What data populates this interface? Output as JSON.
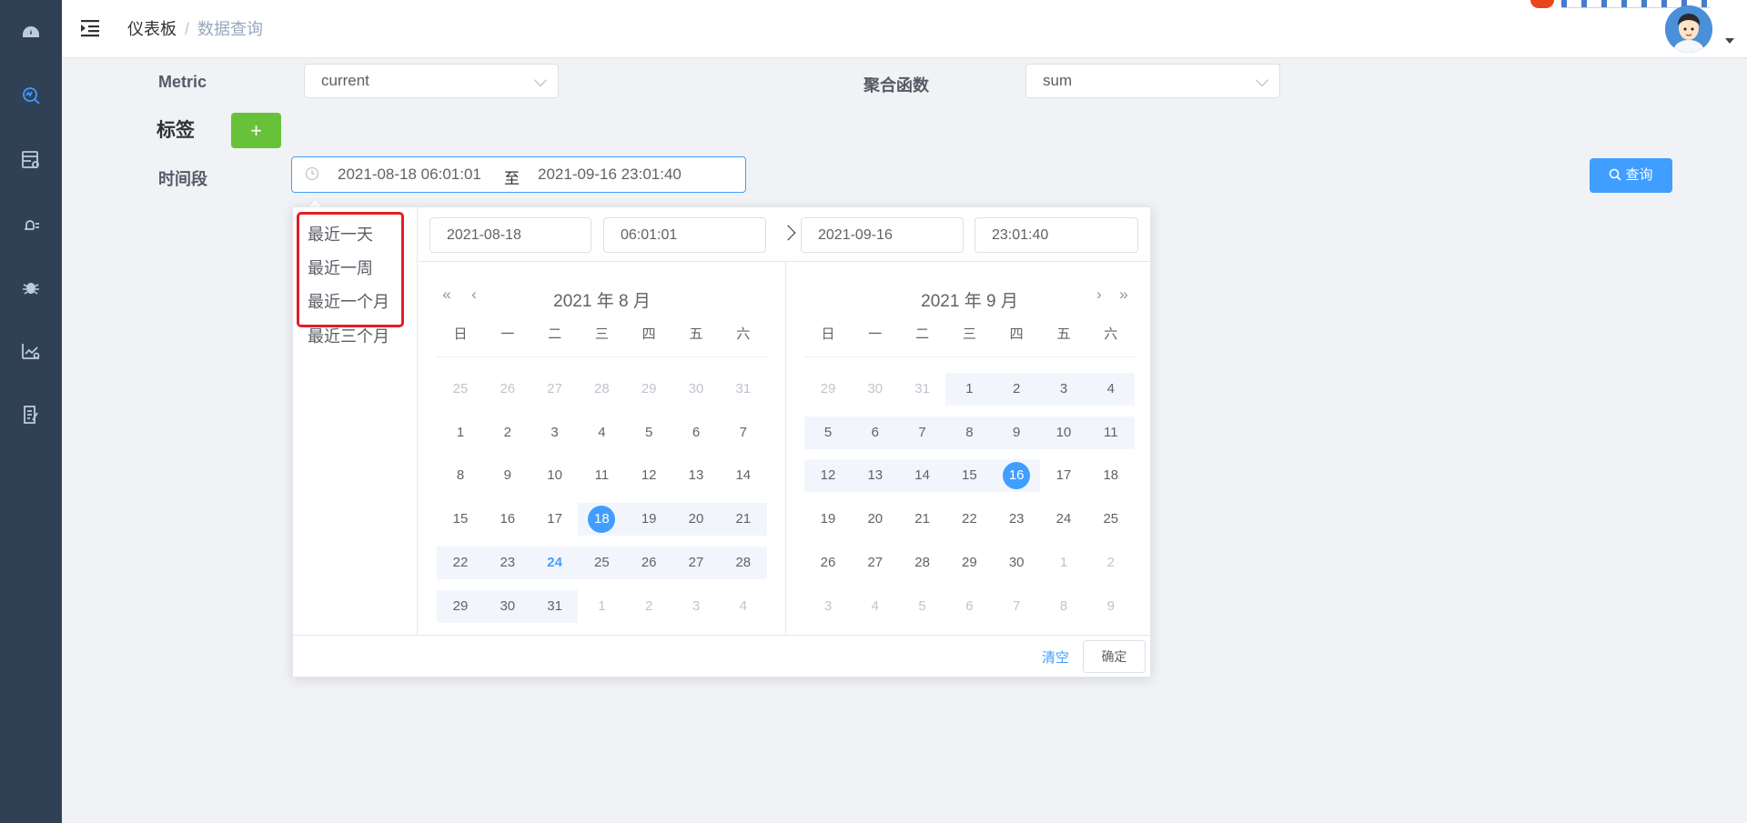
{
  "breadcrumb": {
    "home": "仪表板",
    "separator": "/",
    "current": "数据查询"
  },
  "sidebar": {
    "icons": [
      "dashboard-icon",
      "data-query-icon",
      "server-config-icon",
      "alarm-icon",
      "bug-icon",
      "chart-settings-icon",
      "report-icon"
    ],
    "active": "data-query-icon"
  },
  "form": {
    "metric_label": "Metric",
    "metric_value": "current",
    "agg_label": "聚合函数",
    "agg_value": "sum",
    "tags_label": "标签",
    "add_label": "+",
    "period_label": "时间段",
    "range_start": "2021-08-18 06:01:01",
    "range_sep": "至",
    "range_end": "2021-09-16 23:01:40",
    "query_label": "查询"
  },
  "picker": {
    "shortcuts": [
      "最近一天",
      "最近一周",
      "最近一个月",
      "最近三个月"
    ],
    "start_date": "2021-08-18",
    "start_time": "06:01:01",
    "end_date": "2021-09-16",
    "end_time": "23:01:40",
    "weekdays": [
      "日",
      "一",
      "二",
      "三",
      "四",
      "五",
      "六"
    ],
    "left_title": "2021 年 8 月",
    "right_title": "2021 年 9 月",
    "left_days": [
      [
        "25",
        "26",
        "27",
        "28",
        "29",
        "30",
        "31"
      ],
      [
        "1",
        "2",
        "3",
        "4",
        "5",
        "6",
        "7"
      ],
      [
        "8",
        "9",
        "10",
        "11",
        "12",
        "13",
        "14"
      ],
      [
        "15",
        "16",
        "17",
        "18",
        "19",
        "20",
        "21"
      ],
      [
        "22",
        "23",
        "24",
        "25",
        "26",
        "27",
        "28"
      ],
      [
        "29",
        "30",
        "31",
        "1",
        "2",
        "3",
        "4"
      ]
    ],
    "right_days": [
      [
        "29",
        "30",
        "31",
        "1",
        "2",
        "3",
        "4"
      ],
      [
        "5",
        "6",
        "7",
        "8",
        "9",
        "10",
        "11"
      ],
      [
        "12",
        "13",
        "14",
        "15",
        "16",
        "17",
        "18"
      ],
      [
        "19",
        "20",
        "21",
        "22",
        "23",
        "24",
        "25"
      ],
      [
        "26",
        "27",
        "28",
        "29",
        "30",
        "1",
        "2"
      ],
      [
        "3",
        "4",
        "5",
        "6",
        "7",
        "8",
        "9"
      ]
    ],
    "today": "2021-08-24",
    "clear_label": "清空",
    "confirm_label": "确定"
  }
}
